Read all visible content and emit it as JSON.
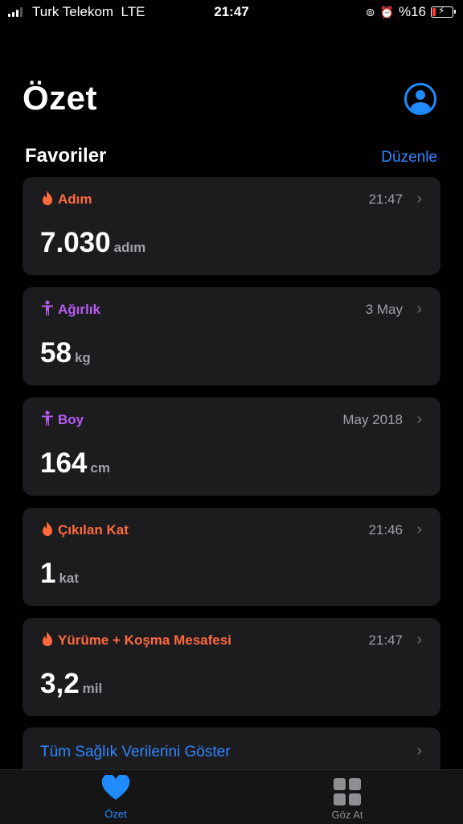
{
  "status_bar": {
    "carrier": "Turk Telekom",
    "network": "LTE",
    "time": "21:47",
    "battery": "%16",
    "battery_color": "#ff3b30"
  },
  "header": {
    "title": "Özet",
    "avatar_icon": "person-circle-icon"
  },
  "favorites": {
    "title": "Favoriler",
    "edit_label": "Düzenle",
    "cards": [
      {
        "label": "Adım",
        "icon": "flame-icon",
        "color": "#ff6a3d",
        "time": "21:47",
        "value": "7.030",
        "unit": "adım"
      },
      {
        "label": "Ağırlık",
        "icon": "figure-icon",
        "color": "#b65cf0",
        "time": "3 May",
        "value": "58",
        "unit": "kg"
      },
      {
        "label": "Boy",
        "icon": "figure-icon",
        "color": "#b65cf0",
        "time": "May 2018",
        "value": "164",
        "unit": "cm"
      },
      {
        "label": "Çıkılan Kat",
        "icon": "flame-icon",
        "color": "#ff6a3d",
        "time": "21:46",
        "value": "1",
        "unit": "kat"
      },
      {
        "label": "Yürüme + Koşma Mesafesi",
        "icon": "flame-icon",
        "color": "#ff6a3d",
        "time": "21:47",
        "value": "3,2",
        "unit": "mil"
      }
    ]
  },
  "show_all": {
    "label": "Tüm Sağlık Verilerini Göster"
  },
  "tab_bar": {
    "tabs": [
      {
        "label": "Özet",
        "icon": "heart-icon",
        "active": true
      },
      {
        "label": "Göz At",
        "icon": "grid-icon",
        "active": false
      }
    ],
    "active_color": "#1f8bff"
  }
}
